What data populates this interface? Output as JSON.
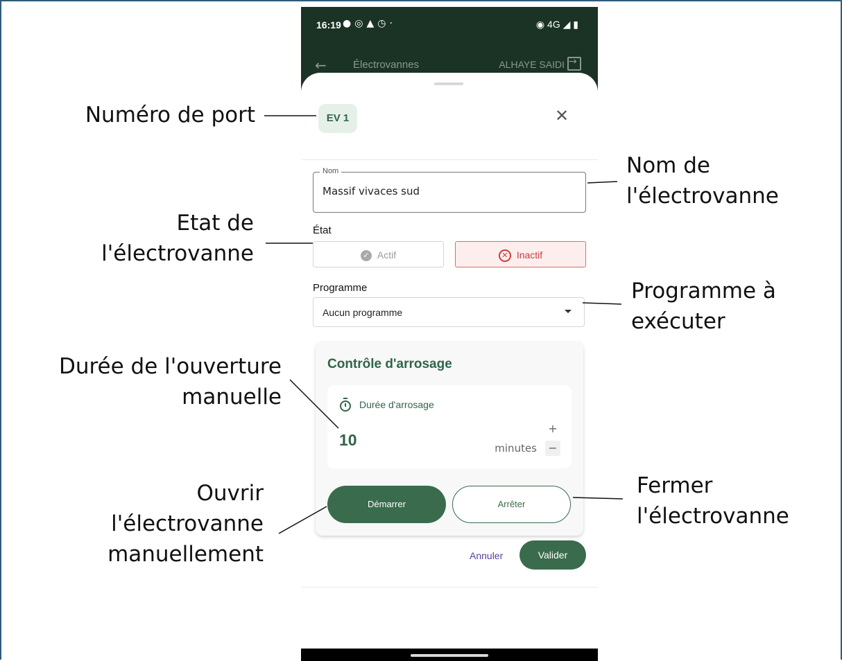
{
  "status_bar": {
    "time": "16:19",
    "left_icons": [
      "chat-icon",
      "whatsapp-icon",
      "warning-icon",
      "alarm-icon",
      "dot-icon"
    ],
    "right_text": "4G",
    "right_icons": [
      "hotspot-icon",
      "signal-icon",
      "battery-icon"
    ]
  },
  "app_bar": {
    "title": "Électrovannes",
    "user": "ALHAYE SAIDI",
    "back_icon": "arrow-left-icon",
    "logout_icon": "logout-icon"
  },
  "sheet": {
    "port_label": "EV 1",
    "close_icon": "close-icon",
    "name_field": {
      "legend": "Nom",
      "value": "Massif vivaces sud"
    },
    "state": {
      "label": "État",
      "active_label": "Actif",
      "inactive_label": "Inactif",
      "selected": "Inactif",
      "active_color": "#a9a9a9",
      "inactive_color": "#d23a3a"
    },
    "program": {
      "label": "Programme",
      "value": "Aucun programme"
    },
    "control": {
      "title": "Contrôle d'arrosage",
      "duration_label": "Durée d'arrosage",
      "duration_value": "10",
      "duration_unit": "minutes",
      "plus": "+",
      "minus": "−",
      "start_label": "Démarrer",
      "stop_label": "Arrêter"
    },
    "footer": {
      "cancel_label": "Annuler",
      "validate_label": "Valider"
    }
  },
  "annotations": {
    "port_number": "Numéro de port",
    "valve_name_1": "Nom de",
    "valve_name_2": "l'électrovanne",
    "valve_state_1": "Etat de",
    "valve_state_2": "l'électrovanne",
    "program_1": "Programme à",
    "program_2": "exécuter",
    "manual_duration_1": "Durée de l'ouverture",
    "manual_duration_2": "manuelle",
    "open_manual_1": "Ouvrir",
    "open_manual_2": "l'électrovanne",
    "open_manual_3": "manuellement",
    "close_valve_1": "Fermer",
    "close_valve_2": "l'électrovanne"
  },
  "colors": {
    "app_bar_bg": "#1b3325",
    "primary_green": "#3a6b4d",
    "accent_purple": "#5a3e98",
    "error_red": "#d23a3a",
    "frame_border": "#2e5a7a"
  }
}
